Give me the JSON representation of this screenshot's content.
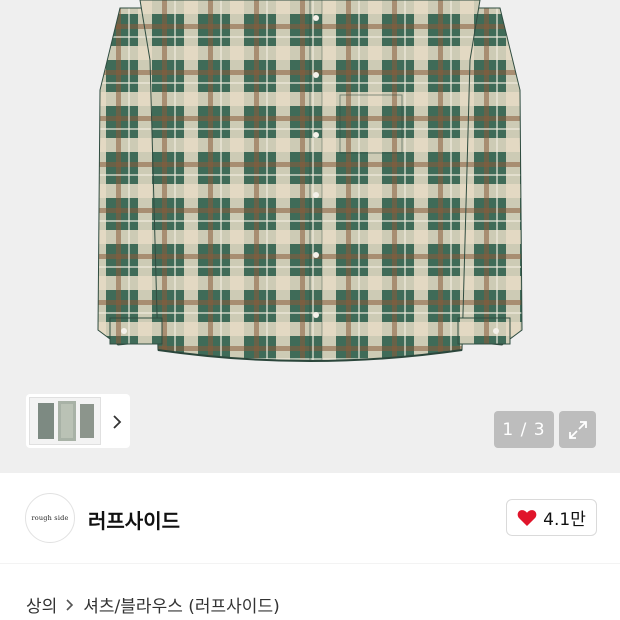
{
  "gallery": {
    "counter": "1 / 3",
    "thumbnail_count": 3
  },
  "brand": {
    "logo_text": "rough side",
    "name": "러프사이드"
  },
  "likes": {
    "count": "4.1만"
  },
  "breadcrumb": {
    "category": "상의",
    "subcategory": "셔츠/블라우스 (러프사이드)"
  },
  "colors": {
    "like_heart": "#e0152b",
    "pager_bg": "#bdbdbd",
    "shirt_green": "#3f6b58",
    "shirt_cream": "#e7dcc6"
  },
  "icons": {
    "thumb_next": "chevron-right-icon",
    "expand": "expand-arrows-icon",
    "like": "heart-icon",
    "breadcrumb_sep": "chevron-right-icon"
  }
}
